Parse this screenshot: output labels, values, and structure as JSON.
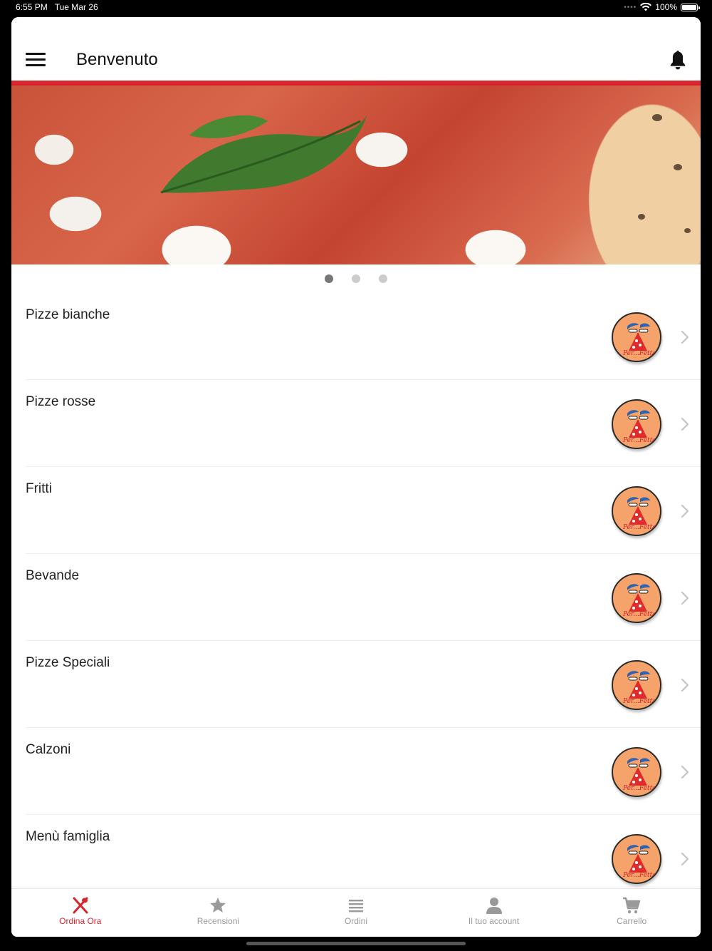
{
  "status": {
    "time": "6:55 PM",
    "date": "Tue Mar 26",
    "battery": "100%"
  },
  "header": {
    "title": "Benvenuto",
    "menu_icon": "hamburger-menu-icon",
    "notif_icon": "bell-icon"
  },
  "banner": {
    "slides": 3,
    "active_slide": 1
  },
  "categories": [
    {
      "label": "Pizze bianche",
      "logo_text": "Per...Fetta"
    },
    {
      "label": "Pizze rosse",
      "logo_text": "Per...Fetta"
    },
    {
      "label": "Fritti",
      "logo_text": "Per...Fetta"
    },
    {
      "label": "Bevande",
      "logo_text": "Per...Fetta"
    },
    {
      "label": "Pizze Speciali",
      "logo_text": "Per...Fetta"
    },
    {
      "label": "Calzoni",
      "logo_text": "Per...Fetta"
    },
    {
      "label": "Menù famiglia",
      "logo_text": "Per...Fetta"
    }
  ],
  "tabs": [
    {
      "label": "Ordina Ora",
      "icon": "fork-spoon-icon",
      "active": true
    },
    {
      "label": "Recensioni",
      "icon": "star-icon",
      "active": false
    },
    {
      "label": "Ordini",
      "icon": "list-icon",
      "active": false
    },
    {
      "label": "Il tuo account",
      "icon": "user-icon",
      "active": false
    },
    {
      "label": "Carrello",
      "icon": "cart-icon",
      "active": false
    }
  ],
  "colors": {
    "accent": "#d7262e",
    "inactive": "#9a9a9a",
    "logo_bg": "#f5a36b"
  }
}
